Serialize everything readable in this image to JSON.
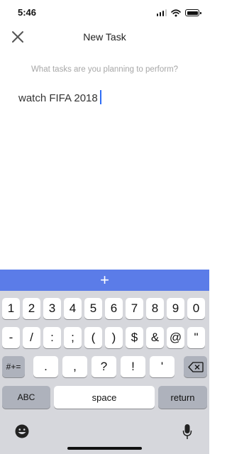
{
  "status_bar": {
    "time": "5:46",
    "signal_bars": 4,
    "signal_bars_on": 3
  },
  "header": {
    "title": "New Task",
    "close_icon": "close-icon"
  },
  "form": {
    "prompt": "What tasks are you planning to perform?",
    "task_value": "watch FIFA 2018"
  },
  "add_bar": {
    "label": "+"
  },
  "colors": {
    "accent": "#5b7ce8",
    "caret": "#2f6df5",
    "keyboard_bg": "#d6d7dc",
    "function_key": "#aeb2bc"
  },
  "keyboard": {
    "row1": [
      "1",
      "2",
      "3",
      "4",
      "5",
      "6",
      "7",
      "8",
      "9",
      "0"
    ],
    "row2": [
      "-",
      "/",
      ":",
      ";",
      "(",
      ")",
      "$",
      "&",
      "@",
      "\""
    ],
    "row3": [
      ".",
      ",",
      "?",
      "!",
      "'"
    ],
    "symbols_key": "#+=",
    "delete_icon": "backspace-icon",
    "abc_key": "ABC",
    "space_key": "space",
    "return_key": "return",
    "emoji_icon": "emoji-icon",
    "mic_icon": "microphone-icon"
  }
}
